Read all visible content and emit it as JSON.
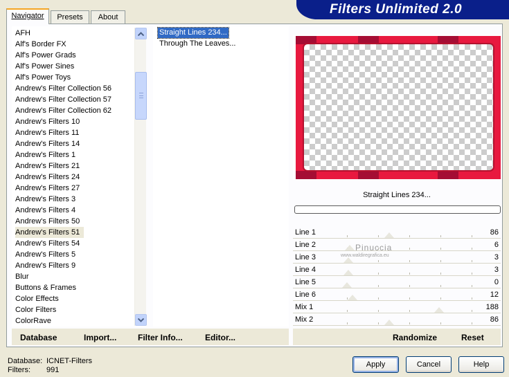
{
  "app": {
    "title": "Filters Unlimited 2.0"
  },
  "tabs": [
    {
      "label": "Navigator",
      "active": true
    },
    {
      "label": "Presets",
      "active": false
    },
    {
      "label": "About",
      "active": false
    }
  ],
  "categories": {
    "items": [
      "AFH",
      "Alf's Border FX",
      "Alf's Power Grads",
      "Alf's Power Sines",
      "Alf's Power Toys",
      "Andrew's Filter Collection 56",
      "Andrew's Filter Collection 57",
      "Andrew's Filter Collection 62",
      "Andrew's Filters 10",
      "Andrew's Filters 11",
      "Andrew's Filters 14",
      "Andrew's Filters 1",
      "Andrew's Filters 21",
      "Andrew's Filters 24",
      "Andrew's Filters 27",
      "Andrew's Filters 3",
      "Andrew's Filters 4",
      "Andrew's Filters 50",
      "Andrew's Filters 51",
      "Andrew's Filters 54",
      "Andrew's Filters 5",
      "Andrew's Filters 9",
      "Blur",
      "Buttons & Frames",
      "Color Effects",
      "Color Filters",
      "ColorRave"
    ],
    "selected_index": 18
  },
  "filters": {
    "items": [
      "Straight Lines 234...",
      "Through The Leaves..."
    ],
    "selected_index": 0
  },
  "preview": {
    "filter_name": "Straight Lines 234...",
    "frame_color": "#e8193f",
    "corner_color": "#a50d34"
  },
  "params": [
    {
      "label": "Line 1",
      "value": "86",
      "slider": 0.337
    },
    {
      "label": "Line 2",
      "value": "6",
      "slider": 0.024
    },
    {
      "label": "Line 3",
      "value": "3",
      "slider": 0.012
    },
    {
      "label": "Line 4",
      "value": "3",
      "slider": 0.012
    },
    {
      "label": "Line 5",
      "value": "0",
      "slider": 0.0
    },
    {
      "label": "Line 6",
      "value": "12",
      "slider": 0.047
    },
    {
      "label": "Mix 1",
      "value": "188",
      "slider": 0.737
    },
    {
      "label": "Mix 2",
      "value": "86",
      "slider": 0.337
    }
  ],
  "watermark": {
    "name": "Pinuccia",
    "site": "www.waldiregrafica.eu"
  },
  "toolbar": {
    "database": "Database",
    "import": "Import...",
    "filter_info": "Filter Info...",
    "editor": "Editor...",
    "randomize": "Randomize",
    "reset": "Reset"
  },
  "status": {
    "database_label": "Database:",
    "database_value": "ICNET-Filters",
    "filters_label": "Filters:",
    "filters_value": "991"
  },
  "buttons": {
    "apply": "Apply",
    "cancel": "Cancel",
    "help": "Help"
  }
}
